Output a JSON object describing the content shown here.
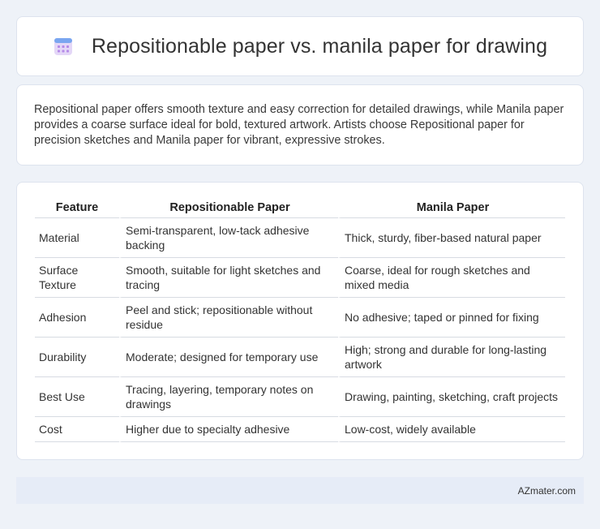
{
  "header": {
    "title": "Repositionable paper vs. manila paper for drawing",
    "icon": "calendar-icon"
  },
  "intro": {
    "text": "Repositional paper offers smooth texture and easy correction for detailed drawings, while Manila paper provides a coarse surface ideal for bold, textured artwork. Artists choose Repositional paper for precision sketches and Manila paper for vibrant, expressive strokes."
  },
  "table": {
    "headers": [
      "Feature",
      "Repositionable Paper",
      "Manila Paper"
    ],
    "rows": [
      [
        "Material",
        "Semi-transparent, low-tack adhesive backing",
        "Thick, sturdy, fiber-based natural paper"
      ],
      [
        "Surface Texture",
        "Smooth, suitable for light sketches and tracing",
        "Coarse, ideal for rough sketches and mixed media"
      ],
      [
        "Adhesion",
        "Peel and stick; repositionable without residue",
        "No adhesive; taped or pinned for fixing"
      ],
      [
        "Durability",
        "Moderate; designed for temporary use",
        "High; strong and durable for long-lasting artwork"
      ],
      [
        "Best Use",
        "Tracing, layering, temporary notes on drawings",
        "Drawing, painting, sketching, craft projects"
      ],
      [
        "Cost",
        "Higher due to specialty adhesive",
        "Low-cost, widely available"
      ]
    ]
  },
  "footer": {
    "brand": "AZmater.com"
  }
}
